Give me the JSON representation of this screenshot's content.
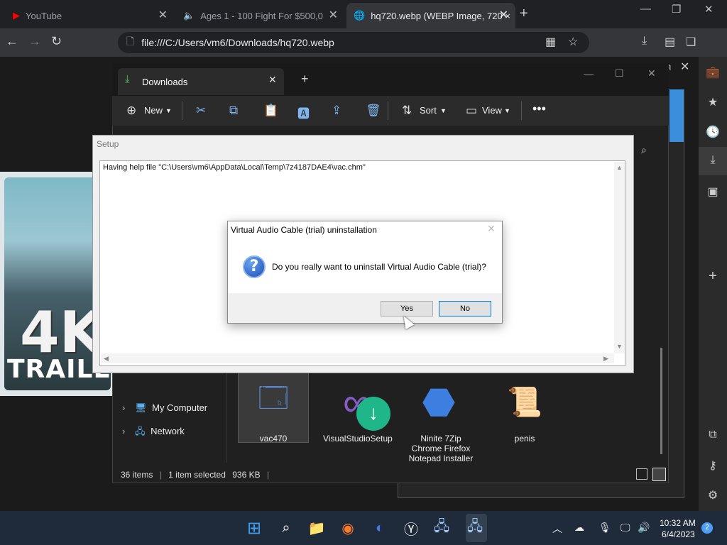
{
  "browser": {
    "tabs": [
      {
        "title": "YouTube",
        "icon": "youtube-icon"
      },
      {
        "title": "Ages 1 - 100 Fight For $500,0",
        "icon": "speaker-icon"
      },
      {
        "title": "hq720.webp (WEBP Image, 720 ×",
        "icon": "globe-icon"
      }
    ],
    "address": "file:///C:/Users/vm6/Downloads/hq720.webp"
  },
  "thumbnail": {
    "big_text": "4K",
    "sub_text": "TRAILE"
  },
  "explorer": {
    "tab_title": "Downloads",
    "commands": {
      "new": "New",
      "sort": "Sort",
      "view": "View"
    },
    "nav": [
      {
        "label": "My Computer",
        "icon": "computer-icon"
      },
      {
        "label": "Network",
        "icon": "network-icon"
      }
    ],
    "files": [
      {
        "name": "vac470",
        "icon": "installer-icon"
      },
      {
        "name": "VisualStudioSetup",
        "icon": "visual-studio-icon"
      },
      {
        "name": "Ninite 7Zip Chrome Firefox Notepad Installer",
        "icon": "ninite-icon"
      },
      {
        "name": "penis",
        "icon": "certificate-icon"
      }
    ],
    "status": {
      "items": "36 items",
      "selected": "1 item selected",
      "size": "936 KB"
    }
  },
  "setup": {
    "title": "Setup",
    "log_line": "Having help file \"C:\\Users\\vm6\\AppData\\Local\\Temp\\7z4187DAE4\\vac.chm\""
  },
  "dialog": {
    "title": "Virtual Audio Cable (trial) uninstallation",
    "message": "Do you really want to uninstall Virtual Audio Cable (trial)?",
    "yes": "Yes",
    "no": "No"
  },
  "taskbar": {
    "time": "10:32 AM",
    "date": "6/4/2023",
    "notifications": "2"
  },
  "colors": {
    "accent": "#0078d7",
    "taskbar": "#1f2a3a"
  }
}
